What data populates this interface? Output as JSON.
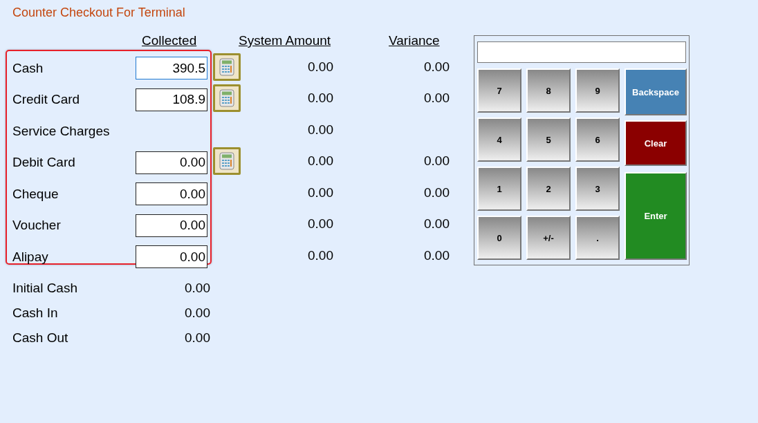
{
  "title": "Counter Checkout For Terminal",
  "columns": {
    "collected": "Collected",
    "system_amount": "System Amount",
    "variance": "Variance"
  },
  "payments": [
    {
      "label": "Cash",
      "kind": "field",
      "collected": "390.5",
      "focused": true,
      "calculator": true,
      "system_amount": "0.00",
      "variance": "0.00"
    },
    {
      "label": "Credit Card",
      "kind": "field",
      "collected": "108.9",
      "focused": false,
      "calculator": true,
      "system_amount": "0.00",
      "variance": "0.00"
    },
    {
      "label": "Service Charges",
      "kind": "text",
      "system_amount": "0.00"
    },
    {
      "label": "Debit Card",
      "kind": "field",
      "collected": "0.00",
      "focused": false,
      "calculator": true,
      "system_amount": "0.00",
      "variance": "0.00"
    },
    {
      "label": "Cheque",
      "kind": "field",
      "collected": "0.00",
      "focused": false,
      "calculator": false,
      "system_amount": "0.00",
      "variance": "0.00"
    },
    {
      "label": "Voucher",
      "kind": "field",
      "collected": "0.00",
      "focused": false,
      "calculator": false,
      "system_amount": "0.00",
      "variance": "0.00"
    },
    {
      "label": "Alipay",
      "kind": "field",
      "collected": "0.00",
      "focused": false,
      "calculator": false,
      "system_amount": "0.00",
      "variance": "0.00"
    }
  ],
  "summary": [
    {
      "label": "Initial Cash",
      "value": "0.00"
    },
    {
      "label": "Cash In",
      "value": "0.00"
    },
    {
      "label": "Cash Out",
      "value": "0.00"
    }
  ],
  "keypad": {
    "keys": [
      "7",
      "8",
      "9",
      "4",
      "5",
      "6",
      "1",
      "2",
      "3",
      "0",
      "+/-",
      "."
    ],
    "actions": [
      {
        "label": "Backspace",
        "kind": "backspace"
      },
      {
        "label": "Clear",
        "kind": "clear"
      },
      {
        "label": "Enter",
        "kind": "enter"
      }
    ]
  }
}
